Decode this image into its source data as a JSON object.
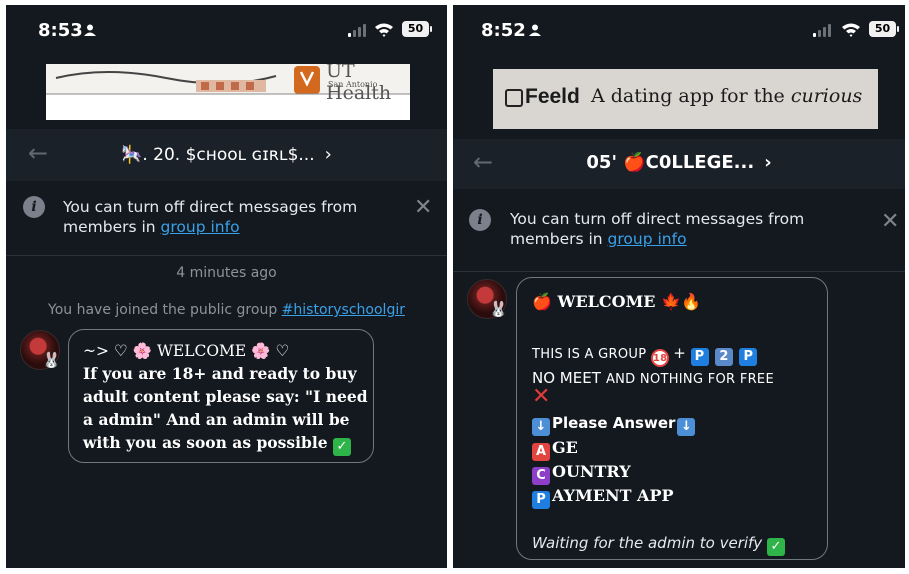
{
  "left": {
    "status": {
      "time": "8:53",
      "battery": "50"
    },
    "ad": {
      "org_name": "UT Health",
      "org_sub": "San Antonio"
    },
    "chat": {
      "title": "🎠. 20. $ᴄʜᴏᴏʟ ɢɪʀʟ$...",
      "chevron": "›",
      "back": "←"
    },
    "notice": {
      "text_pre": "You can turn off direct messages from members in ",
      "link": "group info"
    },
    "timestamp": "4 minutes ago",
    "joined": {
      "text": "You have joined the public group ",
      "group_link": "#historyschoolgir"
    },
    "message": {
      "line1": "~> ♡ 🌸 WELCOME 🌸 ♡",
      "line2": "If you are 18+ and ready to buy",
      "line3": "adult content please say: \"I need",
      "line4": "a admin\" And an admin will be",
      "line5": "with you as soon as possible"
    }
  },
  "right": {
    "status": {
      "time": "8:52",
      "battery": "50"
    },
    "ad": {
      "brand": "Feeld",
      "tagline_pre": "A dating app for the ",
      "tagline_em": "curious"
    },
    "chat": {
      "title": "05' 🍎C𝟬LLEGE...",
      "chevron": "›",
      "back": "←"
    },
    "notice": {
      "text_pre": "You can turn off direct messages from members in ",
      "link": "group info"
    },
    "message": {
      "welcome": "WELCOME",
      "group_line": "THIS IS A GROUP",
      "boxes": [
        "P",
        "2",
        "P"
      ],
      "no_meet": "NO MEET",
      "nothing": "AND NOTHING FOR FREE",
      "please": "Please Answer",
      "age_letter": "A",
      "age": "GE",
      "country_letter": "C",
      "country": "OUNTRY",
      "payment_letter": "P",
      "payment": "AYMENT APP",
      "waiting": "Waiting for the admin to verify"
    }
  },
  "colors": {
    "panel_bg": "#13191f",
    "header_bg": "#1b2128",
    "link": "#3aa0e8",
    "muted": "#8a939c"
  },
  "icons": [
    "person-icon",
    "signal-icon",
    "wifi-icon",
    "battery-icon",
    "back-arrow-icon",
    "chevron-right-icon",
    "info-icon",
    "close-icon",
    "avatar",
    "check-icon",
    "arrow-down-icon"
  ]
}
